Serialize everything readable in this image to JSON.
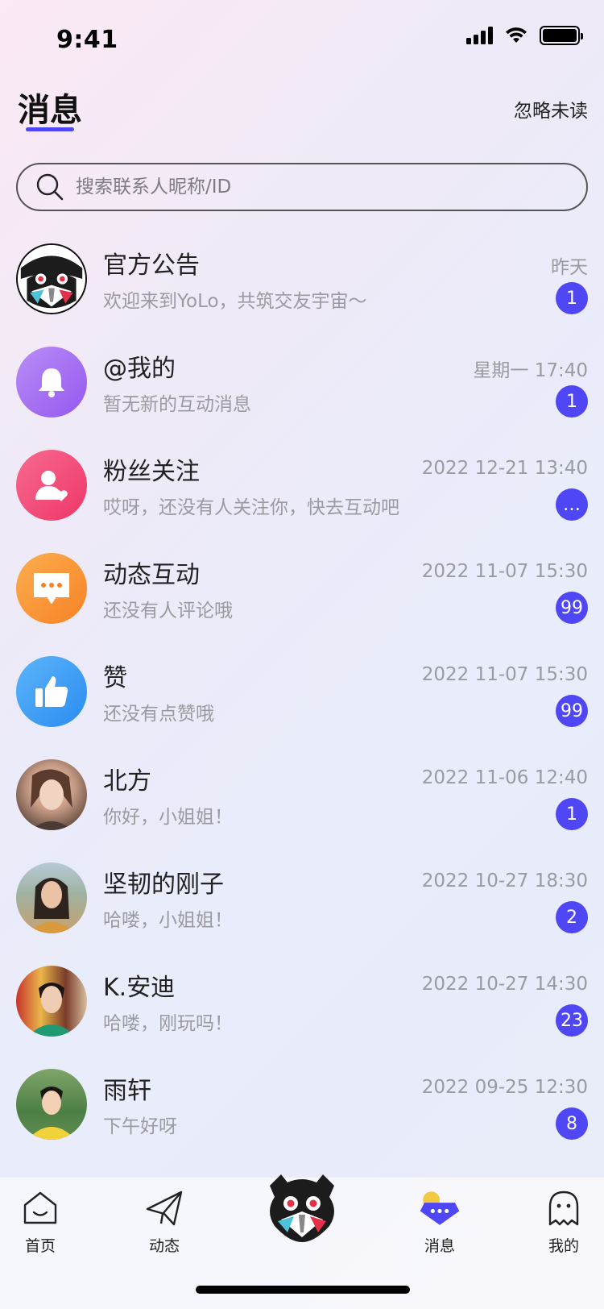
{
  "status": {
    "time": "9:41"
  },
  "header": {
    "title": "消息",
    "ignore_unread": "忽略未读"
  },
  "search": {
    "placeholder": "搜索联系人昵称/ID"
  },
  "messages": [
    {
      "name": "官方公告",
      "preview": "欢迎来到YoLo，共筑交友宇宙～",
      "time": "昨天",
      "badge": "1",
      "avatar": "mascot-avatar"
    },
    {
      "name": "@我的",
      "preview": "暂无新的互动消息",
      "time": "星期一 17:40",
      "badge": "1",
      "avatar": "bell-icon",
      "color": "#a36cf2"
    },
    {
      "name": "粉丝关注",
      "preview": "哎呀，还没有人关注你，快去互动吧",
      "time": "2022 12-21 13:40",
      "badge": "…",
      "avatar": "follower-icon",
      "color": "#f34a7a"
    },
    {
      "name": "动态互动",
      "preview": "还没有人评论哦",
      "time": "2022 11-07 15:30",
      "badge": "99",
      "avatar": "comment-icon",
      "color": "#fa963a"
    },
    {
      "name": "赞",
      "preview": "还没有点赞哦",
      "time": "2022 11-07 15:30",
      "badge": "99",
      "avatar": "thumbs-up-icon",
      "color": "#3a9cf5"
    },
    {
      "name": "北方",
      "preview": "你好，小姐姐！",
      "time": "2022 11-06 12:40",
      "badge": "1",
      "avatar": "user-photo"
    },
    {
      "name": "坚韧的刚子",
      "preview": "哈喽，小姐姐！",
      "time": "2022 10-27 18:30",
      "badge": "2",
      "avatar": "user-photo"
    },
    {
      "name": "K.安迪",
      "preview": "哈喽，刚玩吗！",
      "time": "2022 10-27 14:30",
      "badge": "23",
      "avatar": "user-photo"
    },
    {
      "name": "雨轩",
      "preview": "下午好呀",
      "time": "2022 09-25 12:30",
      "badge": "8",
      "avatar": "user-photo"
    }
  ],
  "tabbar": {
    "home": "首页",
    "feed": "动态",
    "messages": "消息",
    "me": "我的"
  },
  "colors": {
    "accent": "#4f46f5"
  }
}
